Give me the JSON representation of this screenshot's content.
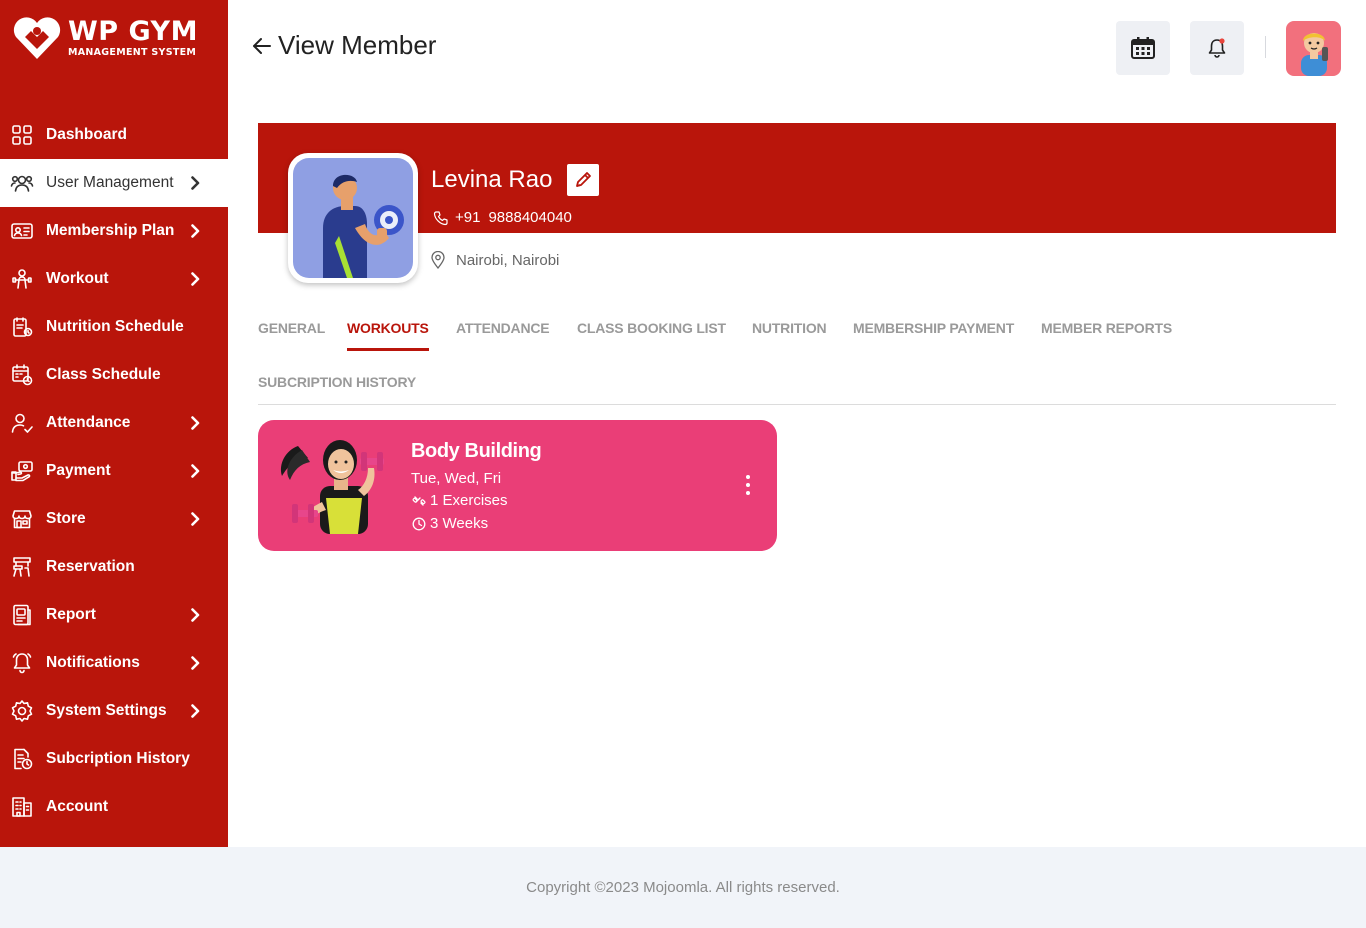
{
  "brand": {
    "title": "WP GYM",
    "subtitle": "MANAGEMENT SYSTEM"
  },
  "sidebar": {
    "items": [
      {
        "label": "Dashboard",
        "icon": "grid-icon",
        "has_submenu": false,
        "active": false
      },
      {
        "label": "User Management",
        "icon": "users-icon",
        "has_submenu": true,
        "active": true
      },
      {
        "label": "Membership Plan",
        "icon": "id-card-icon",
        "has_submenu": true,
        "active": false
      },
      {
        "label": "Workout",
        "icon": "workout-icon",
        "has_submenu": true,
        "active": false
      },
      {
        "label": "Nutrition Schedule",
        "icon": "nutrition-icon",
        "has_submenu": false,
        "active": false
      },
      {
        "label": "Class Schedule",
        "icon": "calendar-clock-icon",
        "has_submenu": false,
        "active": false
      },
      {
        "label": "Attendance",
        "icon": "user-check-icon",
        "has_submenu": true,
        "active": false
      },
      {
        "label": "Payment",
        "icon": "payment-hand-icon",
        "has_submenu": true,
        "active": false
      },
      {
        "label": "Store",
        "icon": "store-icon",
        "has_submenu": true,
        "active": false
      },
      {
        "label": "Reservation",
        "icon": "reservation-icon",
        "has_submenu": false,
        "active": false
      },
      {
        "label": "Report",
        "icon": "report-icon",
        "has_submenu": true,
        "active": false
      },
      {
        "label": "Notifications",
        "icon": "bell-icon",
        "has_submenu": true,
        "active": false
      },
      {
        "label": "System Settings",
        "icon": "gear-icon",
        "has_submenu": true,
        "active": false
      },
      {
        "label": "Subcription History",
        "icon": "history-doc-icon",
        "has_submenu": false,
        "active": false
      },
      {
        "label": "Account",
        "icon": "account-building-icon",
        "has_submenu": false,
        "active": false
      }
    ]
  },
  "header": {
    "title": "View Member",
    "calendar_icon": "calendar-icon",
    "notification_icon": "bell-icon",
    "avatar_icon": "user-avatar-icon"
  },
  "member": {
    "name": "Levina Rao",
    "phone_code": "+91",
    "phone": "9888404040",
    "location": "Nairobi, Nairobi"
  },
  "tabs": [
    {
      "label": "GENERAL",
      "active": false
    },
    {
      "label": "WORKOUTS",
      "active": true
    },
    {
      "label": "ATTENDANCE",
      "active": false
    },
    {
      "label": "CLASS BOOKING LIST",
      "active": false
    },
    {
      "label": "NUTRITION",
      "active": false
    },
    {
      "label": "MEMBERSHIP PAYMENT",
      "active": false
    },
    {
      "label": "MEMBER REPORTS",
      "active": false
    },
    {
      "label": "SUBCRIPTION HISTORY",
      "active": false
    }
  ],
  "workout_card": {
    "title": "Body Building",
    "days": "Tue, Wed, Fri",
    "exercises": "1 Exercises",
    "duration": "3 Weeks"
  },
  "colors": {
    "brand_red": "#b9150b",
    "card_pink": "#ea3e77",
    "avatar_pink": "#f2707d",
    "footer_bg": "#f1f4f9"
  },
  "footer": {
    "copyright": "Copyright ©2023 Mojoomla. All rights reserved."
  }
}
